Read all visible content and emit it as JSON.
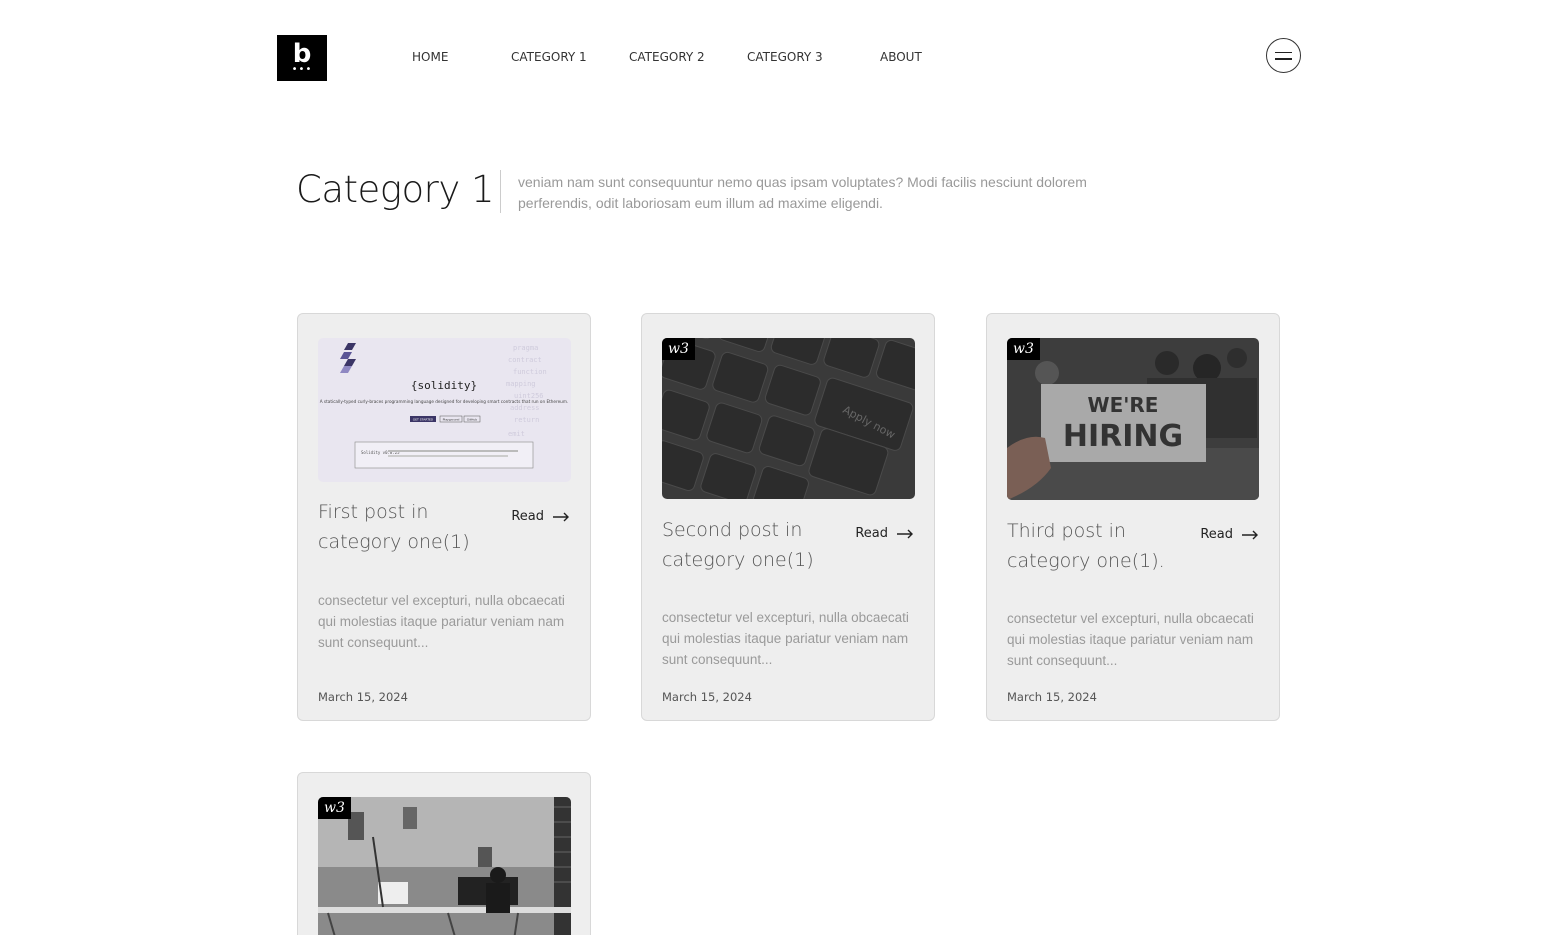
{
  "header": {
    "logo_letter": "b",
    "logo_dots": "•••",
    "nav": [
      "HOME",
      "CATEGORY 1",
      "CATEGORY 2",
      "CATEGORY 3",
      "ABOUT"
    ]
  },
  "page": {
    "title": "Category 1",
    "description": "veniam nam sunt consequuntur nemo quas ipsam voluptates? Modi facilis nesciunt dolorem perferendis, odit laboriosam eum illum ad maxime eligendi."
  },
  "posts": [
    {
      "title": "First post in category one(1)",
      "read_label": "Read",
      "excerpt": "consectetur vel excepturi, nulla obcaecati qui molestias itaque pariatur veniam nam sunt consequunt...",
      "date": "March 15, 2024",
      "image": {
        "brand": "{solidity}",
        "tagline": "A statically-typed curly-braces programming language designed for developing smart contracts that run on Ethereum.",
        "primary_button": "GET STARTED",
        "secondary_buttons": [
          "Playground",
          "GitHub"
        ],
        "version_label": "Solidity v0.8.25"
      }
    },
    {
      "title": "Second post in category one(1)",
      "read_label": "Read",
      "excerpt": "consectetur vel excepturi, nulla obcaecati qui molestias itaque pariatur veniam nam sunt consequunt...",
      "date": "March 15, 2024",
      "badge": "w3",
      "image": {
        "key_text": "Apply now"
      }
    },
    {
      "title": "Third post in category one(1).",
      "read_label": "Read",
      "excerpt": "consectetur vel excepturi, nulla obcaecati qui molestias itaque pariatur veniam nam sunt consequunt...",
      "date": "March 15, 2024",
      "badge": "w3",
      "image": {
        "sign_line1": "WE'RE",
        "sign_line2": "HIRING"
      }
    },
    {
      "badge": "w3"
    }
  ],
  "icons": {
    "menu": "hamburger-icon",
    "read_arrow": "arrow-right-icon"
  }
}
